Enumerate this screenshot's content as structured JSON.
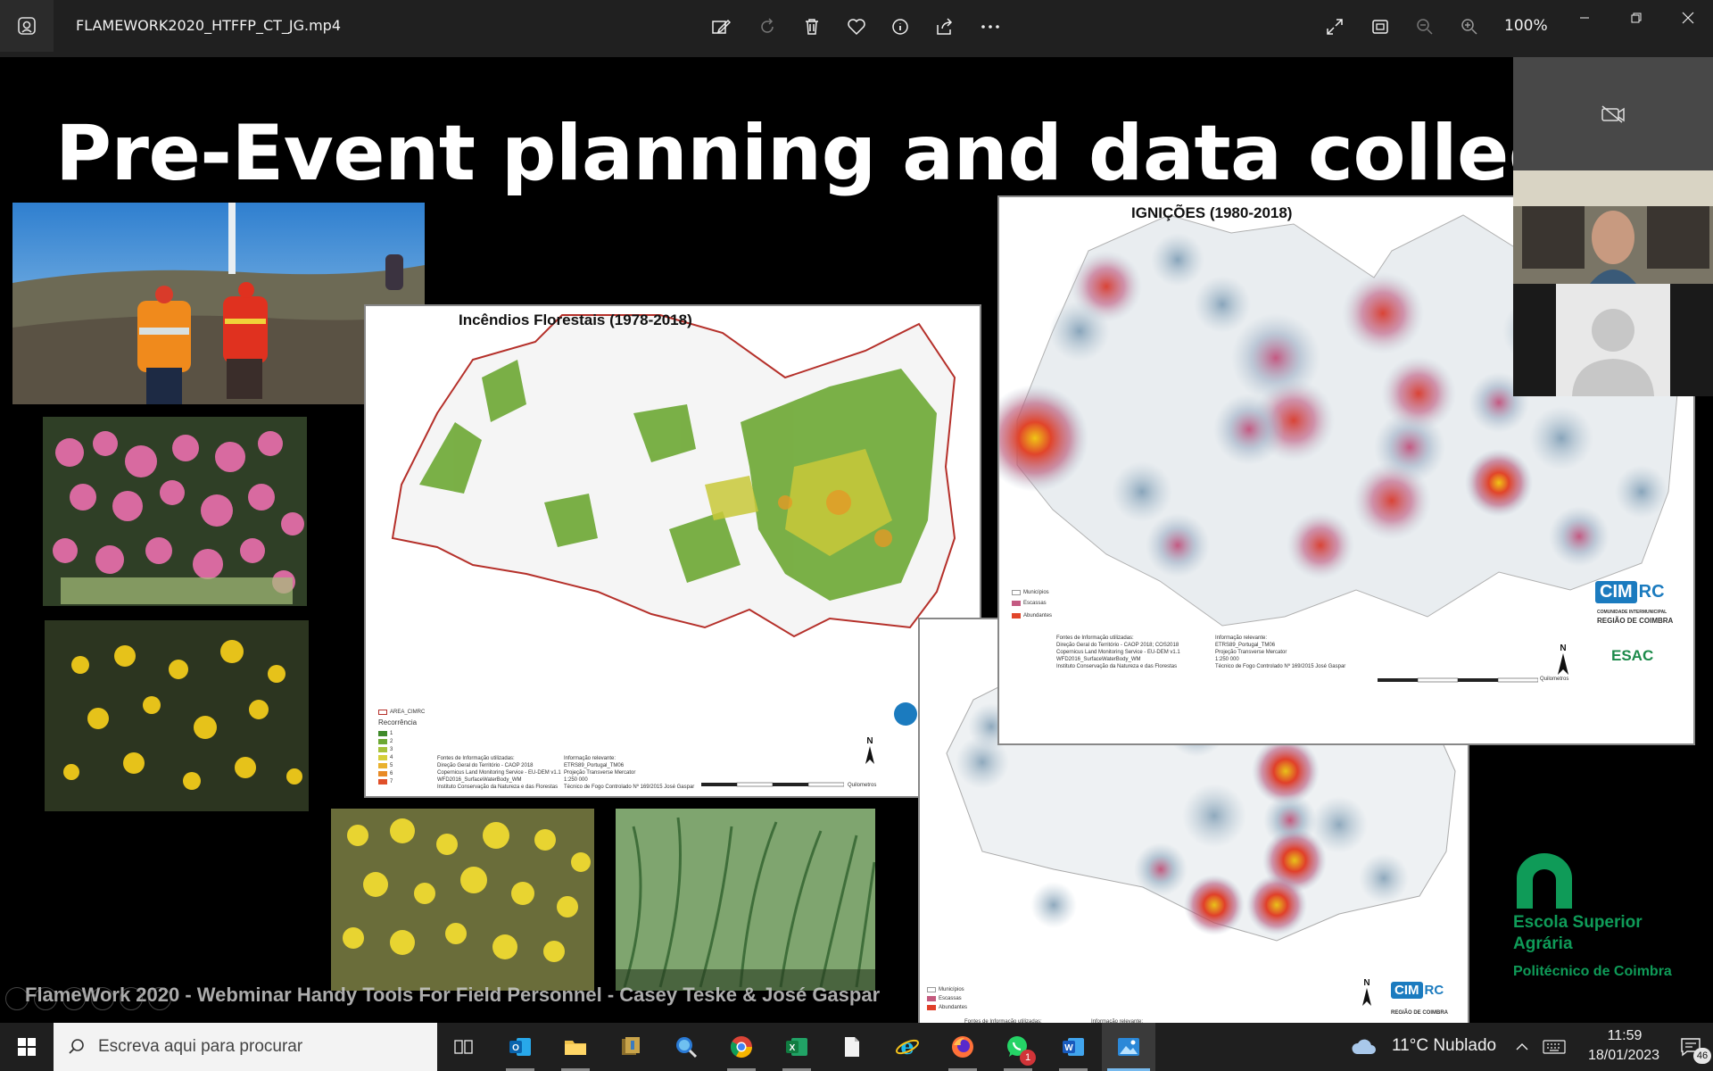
{
  "app": {
    "filename": "FLAMEWORK2020_HTFFP_CT_JG.mp4",
    "zoom": "100%",
    "toolbar_icons": [
      "edit-image-icon",
      "rotate-icon",
      "delete-icon",
      "favorite-icon",
      "info-icon",
      "share-icon",
      "more-icon"
    ],
    "view_icons": [
      "expand-icon",
      "fit-icon",
      "zoom-out-icon",
      "zoom-in-icon"
    ]
  },
  "slide": {
    "title": "Pre-Event planning and data collection to",
    "caption": "FlameWork 2020 - Webminar Handy Tools For Field Personnel - Casey Teske & José Gaspar",
    "map_fire": {
      "title": "Incêndios Florestais (1978-2018)",
      "legend_area": "AREA_CIMRC",
      "legend_title": "Recorrência",
      "legend_items": [
        "1",
        "2",
        "3",
        "4",
        "5",
        "6",
        "7"
      ],
      "sources": "Fontes de Informação utilizadas:\nDireção Geral do Território - CAOP 2018\nCopernicus Land Monitoring Service - EU-DEM v1.1\nWFD2016_SurfaceWaterBody_WM\nInstituto Conservação da Natureza e das Florestas",
      "info": "Informação relevante:\nETRS89_Portugal_TM06\nProjeção Transverse Mercator\n1:250 000\nTécnico de Fogo Controlado Nº 169/2015 José Gaspar",
      "scale_units": "Quilometros",
      "north": "N"
    },
    "map_ignitions": {
      "title": "IGNIÇÕES (1980-2018)",
      "legend": [
        "Municípios",
        "Escassas",
        "Abundantes"
      ],
      "sources": "Fontes de Informação utilizadas:\nDireção Geral do Território - CAOP 2018; COS2018\nCopernicus Land Monitoring Service - EU-DEM v1.1\nWFD2016_SurfaceWaterBody_WM\nInstituto Conservação da Natureza e das Florestas",
      "info": "Informação relevante:\nETRS89_Portugal_TM06\nProjeção Transverse Mercator\n1:250 000\nTécnico de Fogo Controlado Nº 169/2015 José Gaspar",
      "scale_units": "Quilometros",
      "north": "N",
      "cim_text": "CIM",
      "rc_text": "RC",
      "cim_sub1": "COMUNIDADE INTERMUNICIPAL",
      "cim_sub2": "REGIÃO DE COIMBRA",
      "esac_text": "ESAC"
    },
    "brand": {
      "name_line1": "Escola Superior",
      "name_line2": "Agrária",
      "institution": "Politécnico de Coimbra"
    }
  },
  "taskbar": {
    "search_placeholder": "Escreva aqui para procurar",
    "weather": "11°C  Nublado",
    "time": "11:59",
    "date": "18/01/2023",
    "notifications": "46",
    "whatsapp_badge": "1"
  },
  "colors": {
    "titlebar": "#202020",
    "taskbar": "#1f1f1f",
    "accent": "#76b9ed",
    "esa_green": "#0f9b58",
    "cim_blue": "#1b7bbf"
  }
}
